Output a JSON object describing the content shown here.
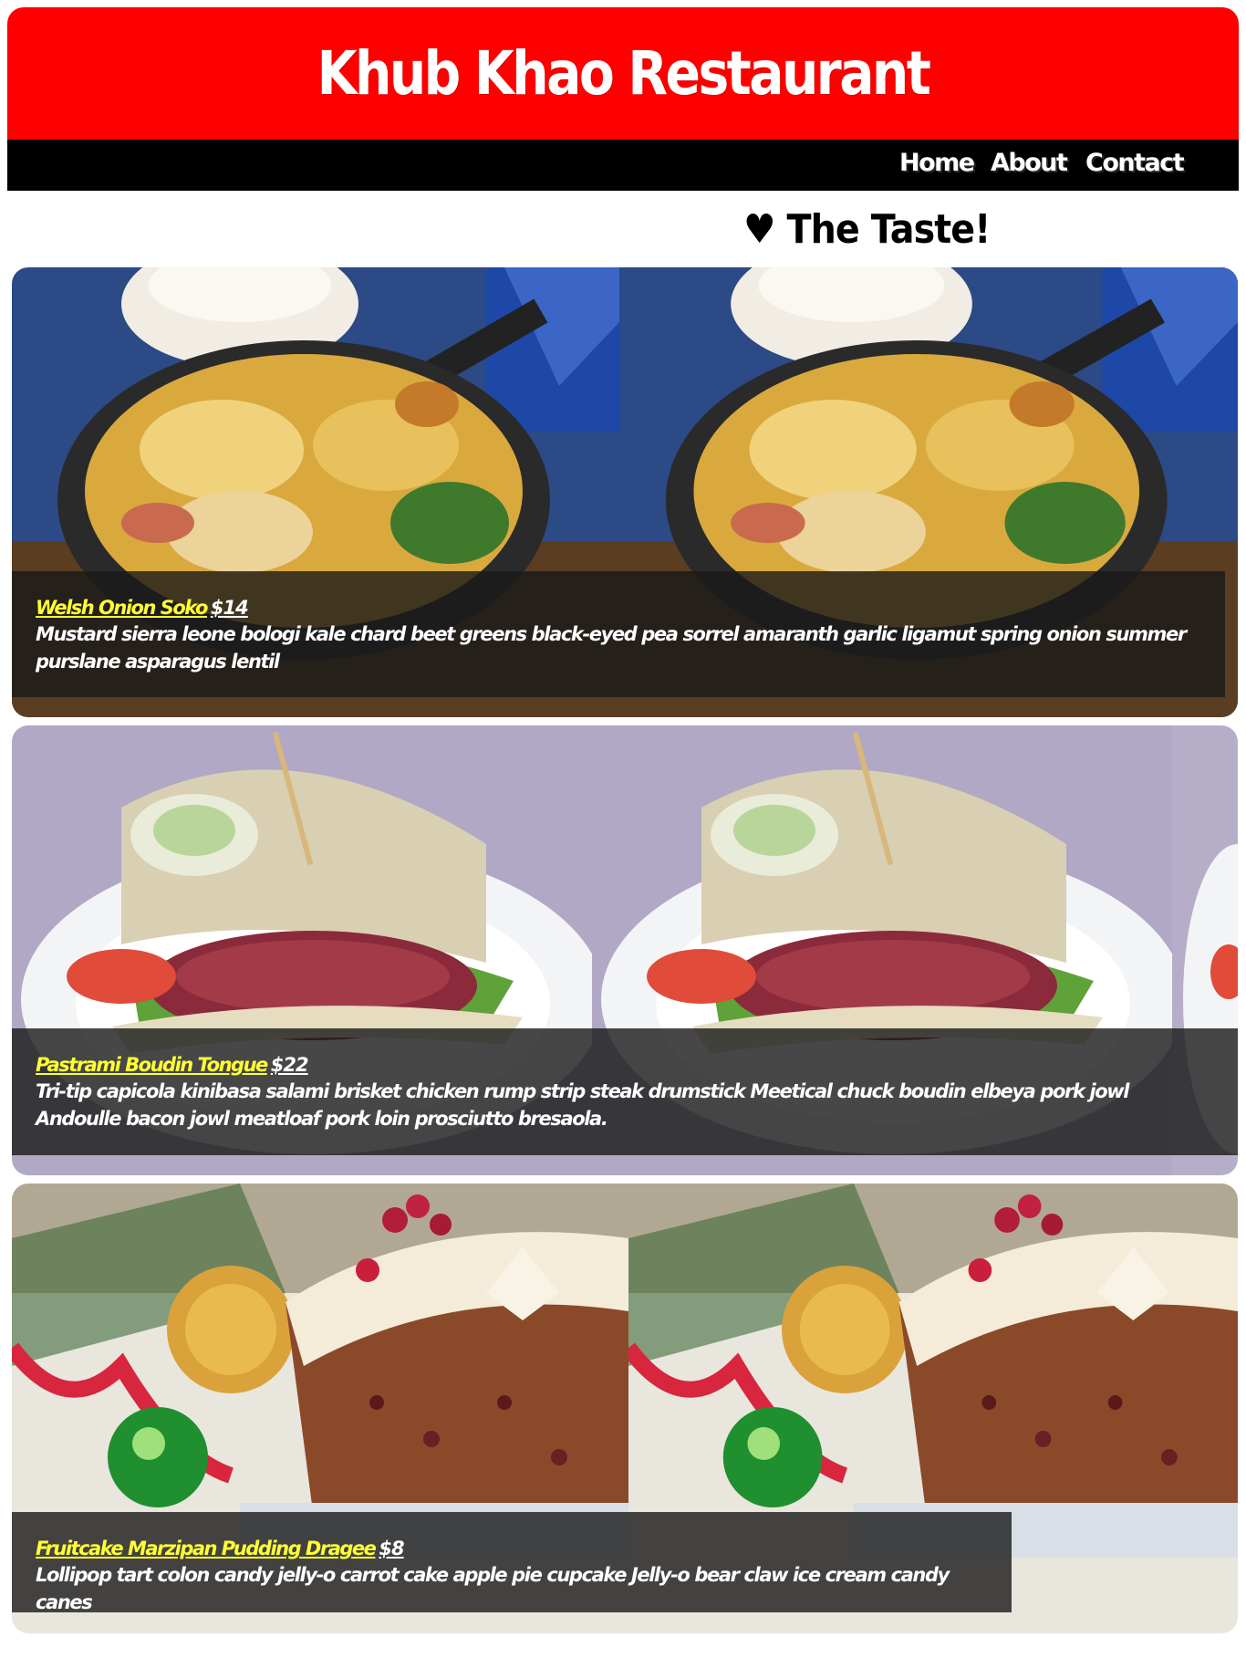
{
  "header": {
    "title": "Khub Khao Restaurant"
  },
  "nav": {
    "items": [
      {
        "label": "Home"
      },
      {
        "label": "About"
      },
      {
        "label": "Contact"
      }
    ]
  },
  "tagline": "♥ The Taste!",
  "menu": {
    "items": [
      {
        "name": "Welsh Onion Soko",
        "price": "$14",
        "description": "Mustard sierra leone bologi kale chard beet greens black-eyed pea sorrel amaranth garlic ligamut spring onion summer purslane asparagus lentil",
        "image_icon": "potato-skillet-photo"
      },
      {
        "name": "Pastrami Boudin Tongue",
        "price": "$22",
        "description": "Tri-tip capicola kinibasa salami brisket chicken rump strip steak drumstick Meetical chuck boudin elbeya pork jowl Andoulle bacon jowl meatloaf pork loin prosciutto bresaola.",
        "image_icon": "pastrami-sandwich-photo"
      },
      {
        "name": "Fruitcake Marzipan Pudding Dragee",
        "price": "$8",
        "description": "Lollipop tart colon candy jelly-o carrot cake apple pie cupcake Jelly-o bear claw ice cream candy canes",
        "image_icon": "fruitcake-photo"
      }
    ]
  },
  "colors": {
    "header_bg": "#ff0000",
    "nav_bg": "#000000",
    "item_name": "#ffff33"
  }
}
